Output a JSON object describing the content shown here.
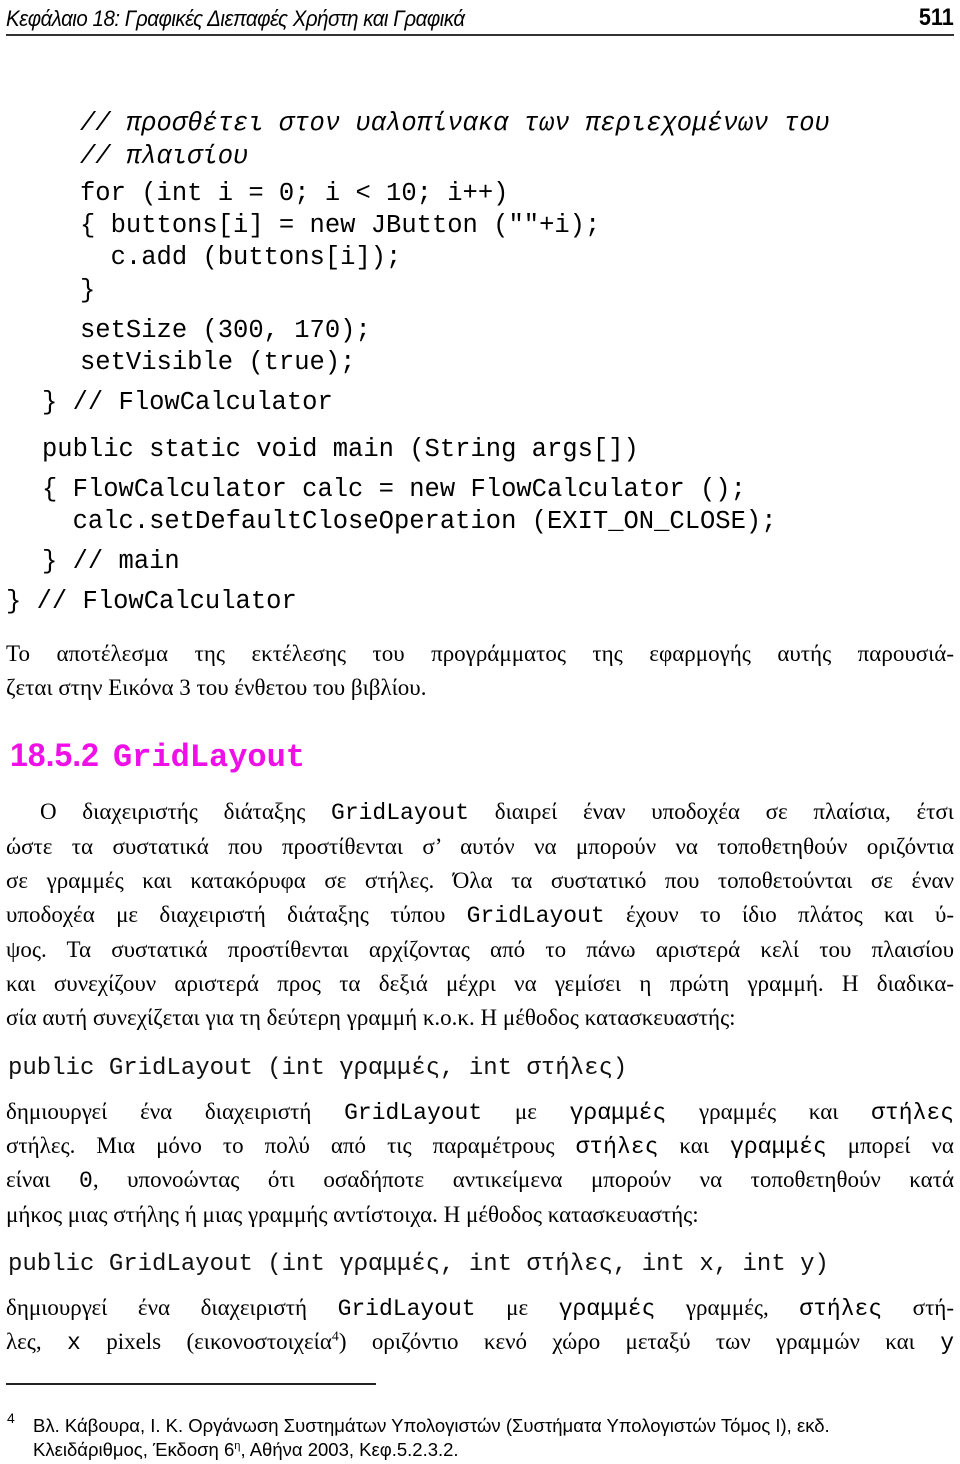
{
  "header": {
    "title": "Κεφάλαιο 18: Γραφικές Διεπαφές Χρήστη και Γραφικά",
    "page_number": "511"
  },
  "code_block_1": {
    "lines": [
      "// προσθέτει στον υαλοπίνακα των περιεχομένων του",
      "// πλαισίου",
      "for (int i = 0; i < 10; i++)",
      "{ buttons[i] = new JButton (\"\"+i);",
      "  c.add (buttons[i]);",
      "}",
      "setSize (300, 170);",
      "setVisible (true);",
      "} // FlowCalculator",
      "public static void main (String args[])",
      "{ FlowCalculator calc = new FlowCalculator ();",
      "  calc.setDefaultCloseOperation (EXIT_ON_CLOSE);",
      "} // main",
      "} // FlowCalculator"
    ]
  },
  "result_paragraph": {
    "line1": "Το αποτέλεσμα της εκτέλεσης του προγράμματος της εφαρμογής αυτής παρουσιά-",
    "line2": "ζεται στην Εικόνα 3 του ένθετου του βιβλίου."
  },
  "section": {
    "number": "18.5.2",
    "title": "GridLayout",
    "color": "#ee10e6"
  },
  "gridlayout_paragraph": {
    "l1a": "Ο διαχειριστής διάταξης ",
    "l1code": "GridLayout",
    "l1b": " διαιρεί έναν υποδοχέα σε πλαίσια, έτσι",
    "l2": "ώστε τα συστατικά που προστίθενται σ’ αυτόν να μπορούν να τοποθετηθούν οριζόντια",
    "l3": "σε γραμμές και κατακόρυφα σε στήλες. Όλα τα συστατικό που τοποθετούνται σε έναν",
    "l4a": "υποδοχέα με διαχειριστή διάταξης τύπου ",
    "l4code": "GridLayout",
    "l4b": " έχουν το ίδιο πλάτος και ύ-",
    "l5": "ψος. Τα συστατικά προστίθενται αρχίζοντας από το πάνω αριστερά κελί του πλαισίου",
    "l6": "και συνεχίζουν αριστερά προς τα δεξιά μέχρι να γεμίσει η πρώτη γραμμή. Η διαδικα-",
    "l7": "σία αυτή συνεχίζεται για τη δεύτερη γραμμή κ.ο.κ. Η μέθοδος κατασκευαστής:"
  },
  "constructor_1": {
    "signature": "public GridLayout (int γραμμές, int στήλες)"
  },
  "constructor_1_desc": {
    "l1a": "δημιουργεί ένα διαχειριστή ",
    "l1code1": "GridLayout",
    "l1b": " με ",
    "l1code2": "γραμμές",
    "l1c": " γραμμές και ",
    "l1code3": "στήλες",
    "l2a": "στήλες. Μια μόνο το πολύ από τις παραμέτρους ",
    "l2code1": "στήλες",
    "l2b": " και ",
    "l2code2": "γραμμές",
    "l2c": " μπορεί να",
    "l3a": "είναι ",
    "l3code": "0",
    "l3b": ", υπονοώντας ότι οσαδήποτε αντικείμενα μπορούν να τοποθετηθούν κατά",
    "l4": "μήκος μιας στήλης ή μιας γραμμής αντίστοιχα. Η μέθοδος κατασκευαστής:"
  },
  "constructor_2": {
    "signature": "public GridLayout (int γραμμές, int στήλες, int x, int y)"
  },
  "constructor_2_desc": {
    "l1a": "δημιουργεί ένα διαχειριστή ",
    "l1code1": "GridLayout",
    "l1b": " με ",
    "l1code2": "γραμμές",
    "l1c": " γραμμές, ",
    "l1code3": "στήλες",
    "l1d": " στή-",
    "l2a": "λες, ",
    "l2code1": "x",
    "l2b": " pixels (εικονοστοιχεία",
    "l2sup": "4",
    "l2c": ") οριζόντιο κενό χώρο μεταξύ των γραμμών και ",
    "l2code2": "y"
  },
  "footnote": {
    "marker": "4",
    "line1": "Βλ. Κάβουρα, Ι. Κ. Οργάνωση Συστημάτων Υπολογιστών (Συστήματα Υπολογιστών Τόμος Ι), εκδ.",
    "line2a": "Κλειδάριθμος, Έκδοση 6",
    "line2sup": "η",
    "line2b": ", Αθήνα 2003, Κεφ.5.2.3.2."
  }
}
